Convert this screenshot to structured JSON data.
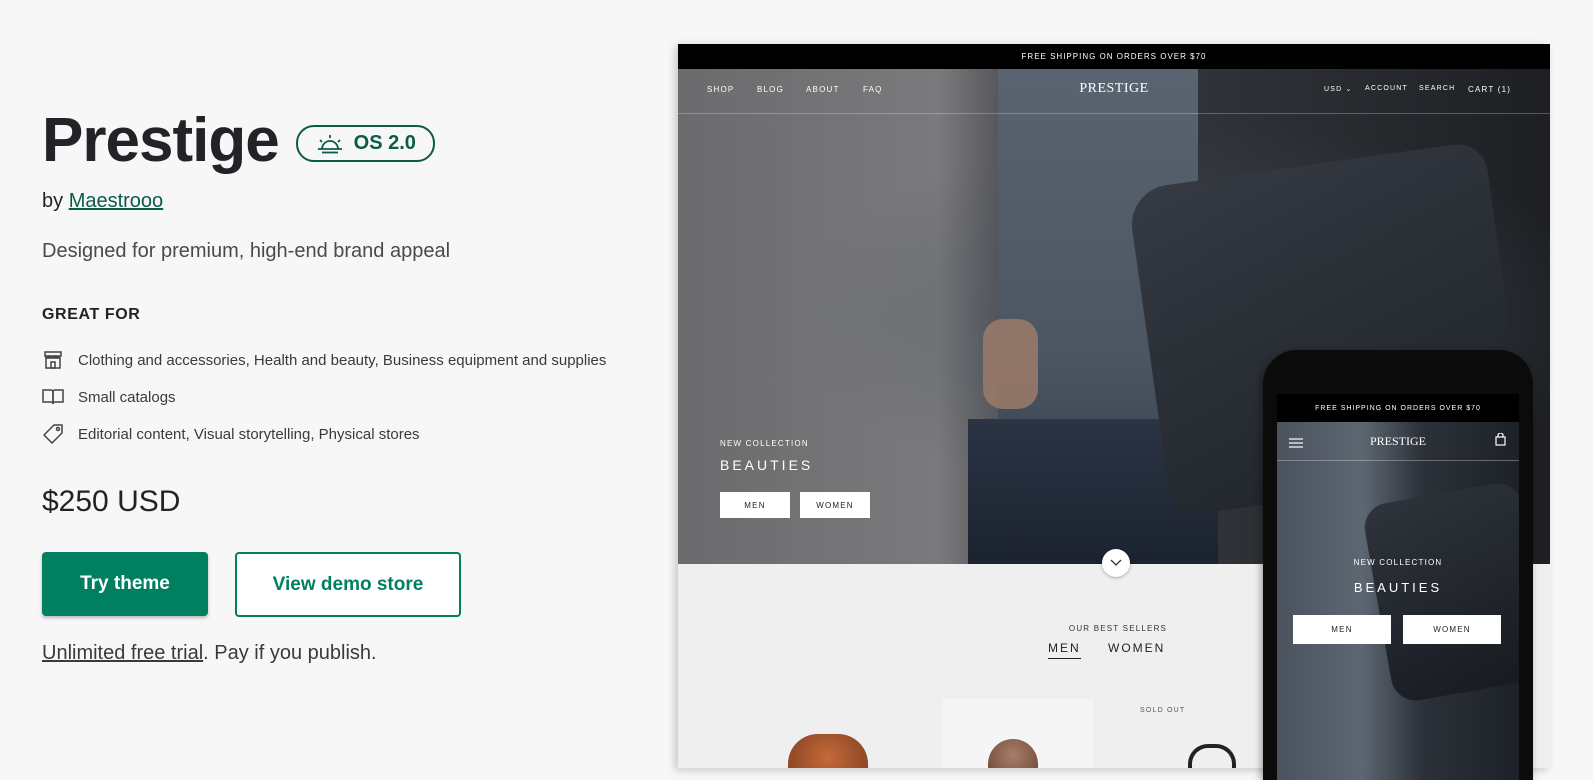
{
  "theme": {
    "name": "Prestige",
    "badge_label": "OS 2.0",
    "by_prefix": "by",
    "author": "Maestrooo",
    "description": "Designed for premium, high-end brand appeal",
    "great_for_heading": "GREAT FOR",
    "features": [
      {
        "icon": "store-icon",
        "text": "Clothing and accessories, Health and beauty, Business equipment and supplies"
      },
      {
        "icon": "book-icon",
        "text": "Small catalogs"
      },
      {
        "icon": "tag-icon",
        "text": "Editorial content, Visual storytelling, Physical stores"
      }
    ],
    "price": "$250 USD",
    "try_label": "Try theme",
    "demo_label": "View demo store",
    "trial_link": "Unlimited free trial",
    "trial_rest": ". Pay if you publish."
  },
  "preview": {
    "announcement": "FREE SHIPPING ON ORDERS OVER $70",
    "nav_left": [
      "SHOP",
      "BLOG",
      "ABOUT",
      "FAQ"
    ],
    "logo": "PRESTIGE",
    "nav_right": [
      "USD",
      "ACCOUNT",
      "SEARCH",
      "CART (1)"
    ],
    "hero_small": "NEW COLLECTION",
    "hero_big": "BEAUTIES",
    "hero_buttons": [
      "MEN",
      "WOMEN"
    ],
    "best_sellers": "OUR BEST SELLERS",
    "tabs": [
      "MEN",
      "WOMEN"
    ],
    "sold_out": "SOLD OUT"
  },
  "mobile": {
    "announcement": "FREE SHIPPING ON ORDERS OVER $70",
    "logo": "PRESTIGE",
    "hero_small": "NEW COLLECTION",
    "hero_big": "BEAUTIES",
    "buttons": [
      "MEN",
      "WOMEN"
    ]
  },
  "colors": {
    "accent": "#008060",
    "badge": "#0a5c4a"
  }
}
